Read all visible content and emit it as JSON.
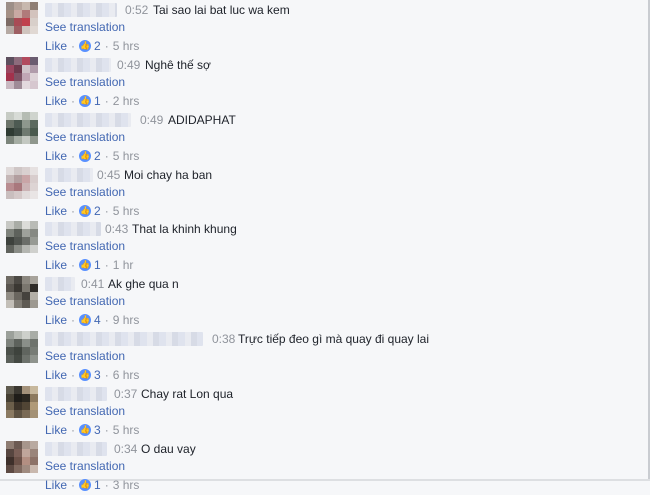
{
  "comments": [
    {
      "time": "0:52",
      "text": "Tai sao lai bat luc wa kem",
      "see_translation": "See translation",
      "like": "Like",
      "likes": "2",
      "age": "5 hrs",
      "avatar": [
        "#9c8f88",
        "#b5a39a",
        "#c7b8ae",
        "#8e7e74",
        "#a48f84",
        "#c9a9a3",
        "#b07a7a",
        "#d3c3bd",
        "#7d6b65",
        "#a94b55",
        "#c0414d",
        "#d8cfca",
        "#b6aaa4",
        "#9e5f63",
        "#cfc4be",
        "#e0d8d3"
      ]
    },
    {
      "time": "0:49",
      "text": "Nghê thế sợ",
      "see_translation": "See translation",
      "like": "Like",
      "likes": "1",
      "age": "2 hrs",
      "avatar": [
        "#5d4f5e",
        "#8d6b7c",
        "#b24a5e",
        "#6a5c70",
        "#9a4660",
        "#6c3a4d",
        "#d0c3c9",
        "#b09cab",
        "#a2324c",
        "#7e5466",
        "#c1a7b5",
        "#ddd3d8",
        "#c9b8c1",
        "#9f8b97",
        "#e3d9de",
        "#d6c7cf"
      ]
    },
    {
      "time": "0:49",
      "text": "ADIDAPHAT",
      "see_translation": "See translation",
      "like": "Like",
      "likes": "2",
      "age": "5 hrs",
      "avatar": [
        "#c6cbc4",
        "#d7dbd6",
        "#b5bcb3",
        "#cfd4ce",
        "#6b7369",
        "#4d5a52",
        "#8e978d",
        "#5c6a5f",
        "#2f3b33",
        "#3f4b44",
        "#6f7a70",
        "#4a5a4e",
        "#7c857b",
        "#a5ada3",
        "#c3c8c1",
        "#8f978d"
      ]
    },
    {
      "time": "0:45",
      "text": "Moi chay ha ban",
      "see_translation": "See translation",
      "like": "Like",
      "likes": "2",
      "age": "5 hrs",
      "avatar": [
        "#e0dada",
        "#cfc6c6",
        "#d9d0d0",
        "#e6e1e1",
        "#c5b7b7",
        "#b29e9f",
        "#c9a5a7",
        "#d8cdcd",
        "#b98d91",
        "#a9787d",
        "#cbb3b5",
        "#ddd4d4",
        "#c9bebe",
        "#d4c8c8",
        "#e1dbdb",
        "#e9e5e5"
      ]
    },
    {
      "time": "0:43",
      "text": "That la khinh khung",
      "see_translation": "See translation",
      "like": "Like",
      "likes": "1",
      "age": "1 hr",
      "avatar": [
        "#c7c8c4",
        "#a9aca6",
        "#dcdcd9",
        "#b9bbb6",
        "#7e827b",
        "#5e625c",
        "#9ea19b",
        "#868983",
        "#3e423d",
        "#50544f",
        "#6b6e69",
        "#979a94",
        "#5f625c",
        "#8a8d87",
        "#b4b6b1",
        "#cfd0cd"
      ]
    },
    {
      "time": "0:41",
      "text": "Ak ghe qua n",
      "see_translation": "See translation",
      "like": "Like",
      "likes": "4",
      "age": "9 hrs",
      "avatar": [
        "#6e6a63",
        "#4c4944",
        "#8b877f",
        "#a7a39b",
        "#59554f",
        "#3b3833",
        "#7a766e",
        "#2f2c28",
        "#918d85",
        "#6a665f",
        "#45423d",
        "#b3afa7",
        "#c3bfb8",
        "#807c74",
        "#5e5a53",
        "#9d9991"
      ]
    },
    {
      "time": "0:38",
      "text": "Trực tiếp đeo gì mà quay đi quay lai",
      "see_translation": "See translation",
      "like": "Like",
      "likes": "3",
      "age": "6 hrs",
      "avatar": [
        "#9ba09a",
        "#b6bab4",
        "#cdd0cb",
        "#a9ada7",
        "#7d827c",
        "#5d625c",
        "#8a8f89",
        "#6e736d",
        "#4b504a",
        "#3e433d",
        "#60655f",
        "#777c76",
        "#5a5f59",
        "#444943",
        "#6d726c",
        "#8e938d"
      ]
    },
    {
      "time": "0:37",
      "text": "Chay rat Lon qua",
      "see_translation": "See translation",
      "like": "Like",
      "likes": "3",
      "age": "5 hrs",
      "avatar": [
        "#5f5b4f",
        "#3a3730",
        "#a3917a",
        "#c7b89d",
        "#453f33",
        "#1f1d19",
        "#2b2720",
        "#8d7a5e",
        "#6c5f4b",
        "#3d342a",
        "#514535",
        "#b09a78",
        "#8b7a62",
        "#5e5242",
        "#7a6a55",
        "#a39175"
      ]
    },
    {
      "time": "0:34",
      "text": "O dau vay",
      "see_translation": "See translation",
      "like": "Like",
      "likes": "1",
      "age": "3 hrs",
      "avatar": [
        "#8e7c72",
        "#6c5a52",
        "#a7968c",
        "#b9aaa1",
        "#574640",
        "#7a5f57",
        "#c0a69b",
        "#9a857b",
        "#3e302b",
        "#6b5148",
        "#b38f82",
        "#8c7268",
        "#5c4942",
        "#806a60",
        "#a08b80",
        "#c9b8ae"
      ]
    }
  ]
}
